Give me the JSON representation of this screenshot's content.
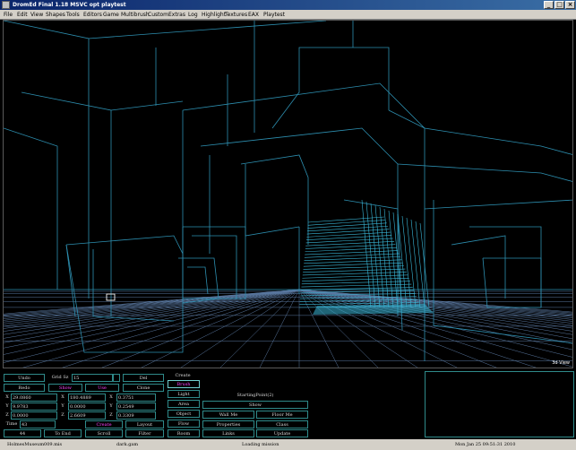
{
  "window": {
    "title": "DromEd Final 1.18 MSVC opt playtest",
    "controls": [
      "_",
      "□",
      "×"
    ]
  },
  "menu": [
    "File",
    "Edit",
    "View",
    "Shapes",
    "Tools",
    "Editors",
    "Game",
    "Multibrush",
    "Custom",
    "Extras",
    "Log",
    "Highlight",
    "Textures",
    "EAX",
    "Playtest"
  ],
  "viewport": {
    "label": "3d View",
    "wire_color": "#2d8fb0",
    "grid_color": "#5a78a0",
    "stair_color": "#3ab8d8",
    "marker_color": "#e8e8e8"
  },
  "panel": {
    "undo": "Undo",
    "redo": "Redo",
    "grid_sz_label": "Grid Sz",
    "grid_sz_value": "15",
    "del": "Del",
    "clone": "Clone",
    "show": "Show",
    "use": "Use",
    "x_label": "X",
    "y_label": "Y",
    "z_label": "Z",
    "pos_x": "29.0860",
    "pos_y": "9.9783",
    "pos_z": "0.0000",
    "size_x_label": "X",
    "size_y_label": "Y",
    "size_z_label": "Z",
    "size_x": "180.4889",
    "size_y": "0.0000",
    "size_z": "2.6609",
    "rot_x_label": "X",
    "rot_y_label": "Y",
    "rot_z_label": "Z",
    "rot_x": "0.3751",
    "rot_y": "0.2549",
    "rot_z": "0.3309",
    "time_label": "Time",
    "time_value": "43",
    "brush_count": "44",
    "to_end": "To End",
    "create_left": "Create",
    "scroll": "Scroll",
    "layout": "Layout",
    "filter": "Filter",
    "create_header": "Create",
    "brush": "Brush",
    "light": "Light",
    "area": "Area",
    "object": "Object",
    "flow": "Flow",
    "room": "Room",
    "object_name": "StartingPoint(2)",
    "show_props": "Show",
    "wall_me": "Wall Me",
    "floor_me": "Floor Me",
    "properties": "Properties",
    "class": "Class",
    "links": "Links",
    "update": "Update",
    "accent_color": "#ff44ff"
  },
  "status": {
    "mission": "HolmesMuseum009.mis",
    "gamesys": "dark.gam",
    "message": "Loading mission",
    "datetime": "Mon Jan 25 09:51:31 2010"
  }
}
